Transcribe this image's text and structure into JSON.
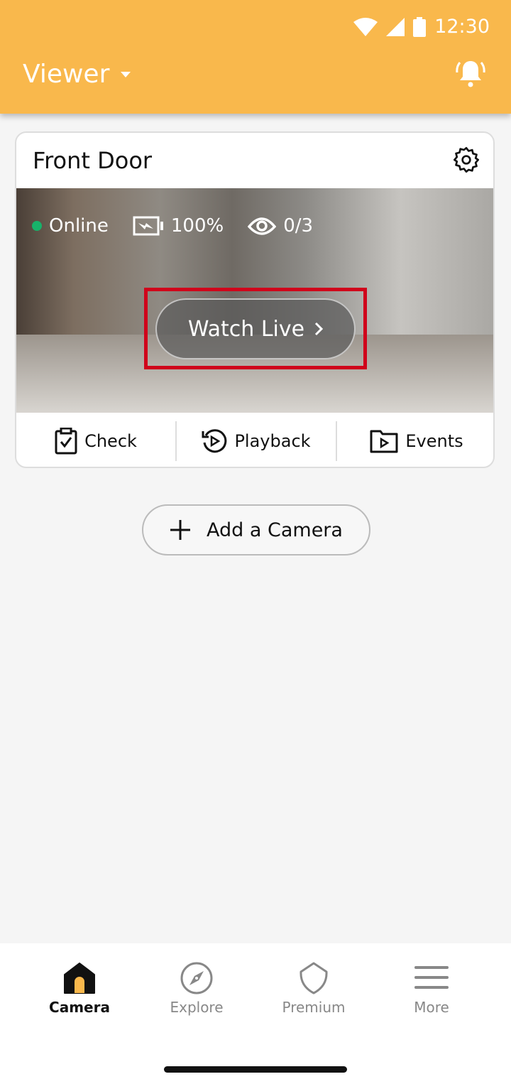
{
  "status_bar": {
    "time": "12:30"
  },
  "appbar": {
    "title": "Viewer",
    "accent": "#f9b84c"
  },
  "camera_card": {
    "name": "Front Door",
    "status": "Online",
    "status_color": "#17b26a",
    "battery": "100%",
    "viewers": "0/3",
    "watch_live": "Watch Live",
    "actions": [
      {
        "label": "Check",
        "icon": "clipboard-check-icon"
      },
      {
        "label": "Playback",
        "icon": "playback-icon"
      },
      {
        "label": "Events",
        "icon": "folder-play-icon"
      }
    ]
  },
  "add_camera": "Add a Camera",
  "bottom_nav": [
    {
      "label": "Camera",
      "active": true
    },
    {
      "label": "Explore"
    },
    {
      "label": "Premium"
    },
    {
      "label": "More"
    }
  ]
}
